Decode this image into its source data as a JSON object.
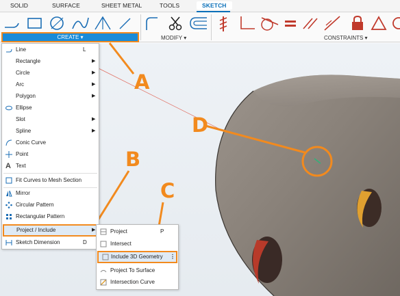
{
  "tabs": [
    "SOLID",
    "SURFACE",
    "SHEET METAL",
    "TOOLS",
    "SKETCH"
  ],
  "toolbar": {
    "create_label": "CREATE ▾",
    "modify_label": "MODIFY ▾",
    "constraints_label": "CONSTRAINTS ▾",
    "create_icons": [
      "line-icon",
      "rectangle-icon",
      "circle-icon",
      "spline-icon",
      "triangle-icon",
      "construction-line-icon"
    ],
    "modify_icons": [
      "fillet-icon",
      "trim-scissors-icon",
      "offset-icon"
    ],
    "constraint_icons": [
      "fix-icon",
      "perpendicular-icon",
      "tangent-icon",
      "equal-icon",
      "parallel-icon",
      "collinear-icon",
      "lock-icon",
      "triangle-constraint-icon",
      "coincident-icon"
    ]
  },
  "create_menu": {
    "items": [
      {
        "label": "Line",
        "shortcut": "L",
        "icon": "line-icon"
      },
      {
        "label": "Rectangle",
        "arrow": true,
        "icon": "rectangle-icon"
      },
      {
        "label": "Circle",
        "arrow": true,
        "icon": "circle-icon"
      },
      {
        "label": "Arc",
        "arrow": true,
        "icon": "arc-icon"
      },
      {
        "label": "Polygon",
        "arrow": true,
        "icon": "polygon-icon"
      },
      {
        "label": "Ellipse",
        "icon": "ellipse-icon"
      },
      {
        "label": "Slot",
        "arrow": true,
        "icon": "slot-icon"
      },
      {
        "label": "Spline",
        "arrow": true,
        "icon": "spline-icon"
      },
      {
        "label": "Conic Curve",
        "icon": "conic-curve-icon"
      },
      {
        "label": "Point",
        "icon": "point-icon"
      },
      {
        "label": "Text",
        "icon": "text-icon"
      },
      {
        "label": "Fit Curves to Mesh Section",
        "icon": "mesh-section-icon"
      },
      {
        "label": "Mirror",
        "icon": "mirror-icon"
      },
      {
        "label": "Circular Pattern",
        "icon": "circular-pattern-icon"
      },
      {
        "label": "Rectangular Pattern",
        "icon": "rectangular-pattern-icon"
      },
      {
        "label": "Project / Include",
        "arrow": true,
        "icon": "project-include-icon"
      },
      {
        "label": "Sketch Dimension",
        "shortcut": "D",
        "icon": "dimension-icon"
      }
    ]
  },
  "project_submenu": {
    "items": [
      {
        "label": "Project",
        "shortcut": "P",
        "icon": "project-icon"
      },
      {
        "label": "Intersect",
        "icon": "intersect-icon"
      },
      {
        "label": "Include 3D Geometry",
        "icon": "include-3d-icon",
        "more": "⋮"
      },
      {
        "label": "Project To Surface",
        "icon": "project-surface-icon"
      },
      {
        "label": "Intersection Curve",
        "icon": "intersection-curve-icon"
      }
    ]
  },
  "callouts": {
    "a": "A",
    "b": "B",
    "c": "C",
    "d": "D"
  },
  "colors": {
    "accent": "#f28a1e",
    "create_button": "#1a8bd8",
    "active_tab": "#0a6fb8",
    "cylinder": "#8a827a",
    "hole_red": "#b83a2a",
    "hole_yellow": "#e0a030"
  }
}
